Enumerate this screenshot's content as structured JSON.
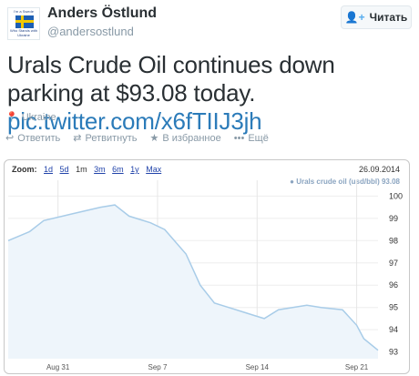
{
  "user": {
    "name": "Anders Östlund",
    "handle": "@andersostlund",
    "avatar_top": "I'm a Swede",
    "avatar_bottom": "Who Stands with Ukraine"
  },
  "follow_button": {
    "label": "Читать"
  },
  "tweet": {
    "text": "Urals Crude Oil continues down parking at $93.08 today. ",
    "link": "pic.twitter.com/x6fTIIJ3jh"
  },
  "location": "Ukraine",
  "actions": {
    "reply": "Ответить",
    "retweet": "Ретвитнуть",
    "favorite": "В избранное",
    "more": "Ещё"
  },
  "chart": {
    "zoom_label": "Zoom:",
    "zoom_options": [
      "1d",
      "5d",
      "1m",
      "3m",
      "6m",
      "1y",
      "Max"
    ],
    "active_zoom": "1m",
    "date": "26.09.2014",
    "legend": "Urals crude oil (usd/bbl) 93.08"
  },
  "chart_data": {
    "type": "line",
    "series": [
      {
        "name": "Urals crude oil (usd/bbl)",
        "points": [
          [
            0,
            98.0
          ],
          [
            3,
            98.4
          ],
          [
            5,
            98.9
          ],
          [
            9,
            99.2
          ],
          [
            13,
            99.5
          ],
          [
            15,
            99.6
          ],
          [
            17,
            99.1
          ],
          [
            20,
            98.8
          ],
          [
            22,
            98.5
          ],
          [
            25,
            97.4
          ],
          [
            27,
            96.0
          ],
          [
            29,
            95.2
          ],
          [
            31,
            95.0
          ],
          [
            33,
            94.8
          ],
          [
            35,
            94.6
          ],
          [
            36,
            94.5
          ],
          [
            38,
            94.9
          ],
          [
            40,
            95.0
          ],
          [
            42,
            95.1
          ],
          [
            44,
            95.0
          ],
          [
            47,
            94.9
          ],
          [
            49,
            94.2
          ],
          [
            50,
            93.6
          ],
          [
            52,
            93.08
          ]
        ],
        "color": "#a8cce8"
      }
    ],
    "x_ticks": [
      {
        "x": 7,
        "label": "Aug 31"
      },
      {
        "x": 21,
        "label": "Sep 7"
      },
      {
        "x": 35,
        "label": "Sep 14"
      },
      {
        "x": 49,
        "label": "Sep 21"
      }
    ],
    "y_ticks": [
      93,
      94,
      95,
      96,
      97,
      98,
      99,
      100
    ],
    "xlim": [
      0,
      52
    ],
    "ylim": [
      92.7,
      100.3
    ],
    "grid": true
  }
}
